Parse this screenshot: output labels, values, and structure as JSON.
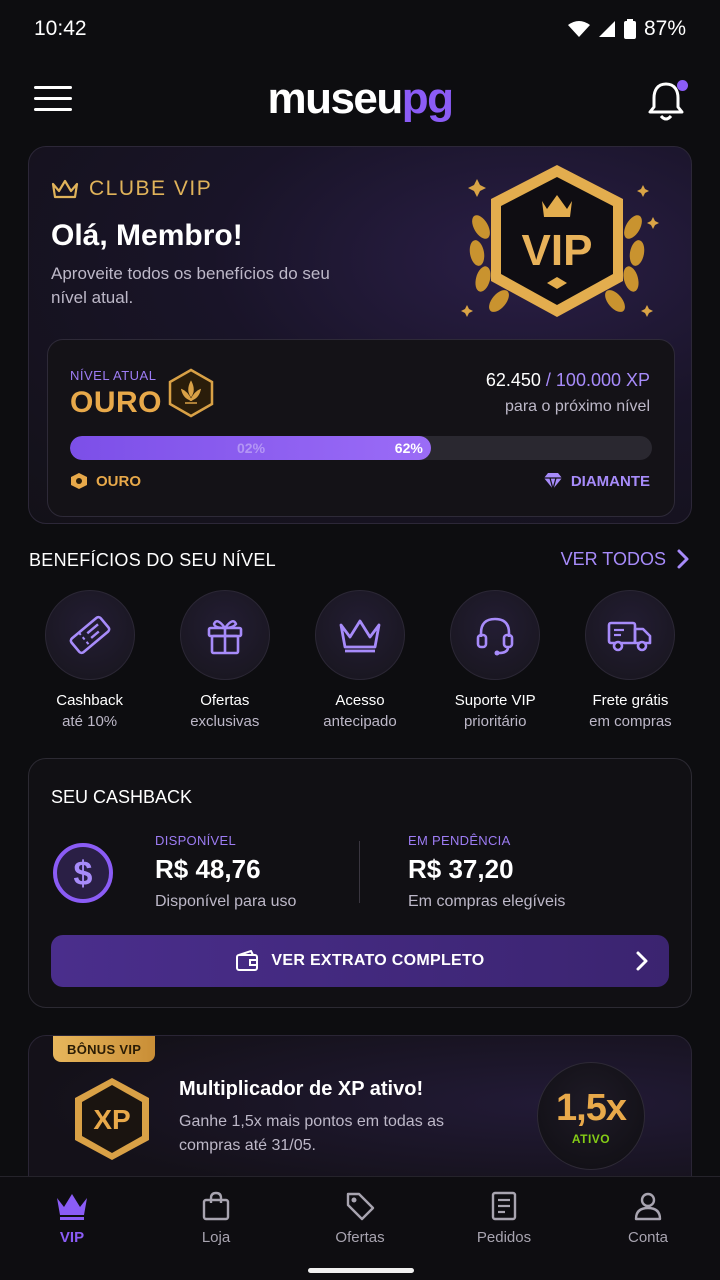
{
  "status_bar": {
    "time": "10:42",
    "battery": "87%"
  },
  "header": {
    "logo_part1": "museu",
    "logo_part2": "pg"
  },
  "vip_card": {
    "club_label": "CLUBE VIP",
    "greeting": "Olá, Membro!",
    "subtitle": "Aproveite todos os benefícios do seu nível atual.",
    "badge_text": "VIP",
    "level_label": "NÍVEL ATUAL",
    "level_value": "OURO",
    "xp_current": "62.450",
    "xp_separator": " / ",
    "xp_goal": "100.000 XP",
    "xp_caption": "para o próximo nível",
    "progress_percent": 62,
    "progress_text": "62%",
    "progress_ghost": "02%",
    "tier_current": "OURO",
    "tier_next": "DIAMANTE"
  },
  "benefits": {
    "title": "BENEFÍCIOS DO SEU NÍVEL",
    "see_all": "VER TODOS",
    "items": [
      {
        "icon": "ticket-icon",
        "title": "Cashback",
        "sub": "até 10%"
      },
      {
        "icon": "gift-icon",
        "title": "Ofertas",
        "sub": "exclusivas"
      },
      {
        "icon": "crown-icon",
        "title": "Acesso",
        "sub": "antecipado"
      },
      {
        "icon": "headset-icon",
        "title": "Suporte VIP",
        "sub": "prioritário"
      },
      {
        "icon": "truck-icon",
        "title": "Frete grátis",
        "sub": "em compras"
      }
    ]
  },
  "cashback": {
    "title": "SEU CASHBACK",
    "available_label": "DISPONÍVEL",
    "available_value": "R$ 48,76",
    "available_sub": "Disponível para uso",
    "pending_label": "EM PENDÊNCIA",
    "pending_value": "R$ 37,20",
    "pending_sub": "Em compras elegíveis",
    "button_label": "VER EXTRATO COMPLETO"
  },
  "bonus": {
    "tag": "BÔNUS VIP",
    "xp_label": "XP",
    "title": "Multiplicador de XP ativo!",
    "subtitle": "Ganhe 1,5x mais pontos em todas as compras até 31/05.",
    "multiplier": "1,5x",
    "multiplier_status": "ATIVO"
  },
  "nav": {
    "items": [
      {
        "label": "VIP",
        "icon": "crown-icon",
        "active": true
      },
      {
        "label": "Loja",
        "icon": "shopping-bag-icon"
      },
      {
        "label": "Ofertas",
        "icon": "tag-icon"
      },
      {
        "label": "Pedidos",
        "icon": "receipt-icon"
      },
      {
        "label": "Conta",
        "icon": "user-icon"
      }
    ]
  },
  "colors": {
    "accent": "#8b5cf6",
    "gold": "#e8a94a",
    "background": "#0d0d10",
    "active_green": "#84cc16"
  }
}
